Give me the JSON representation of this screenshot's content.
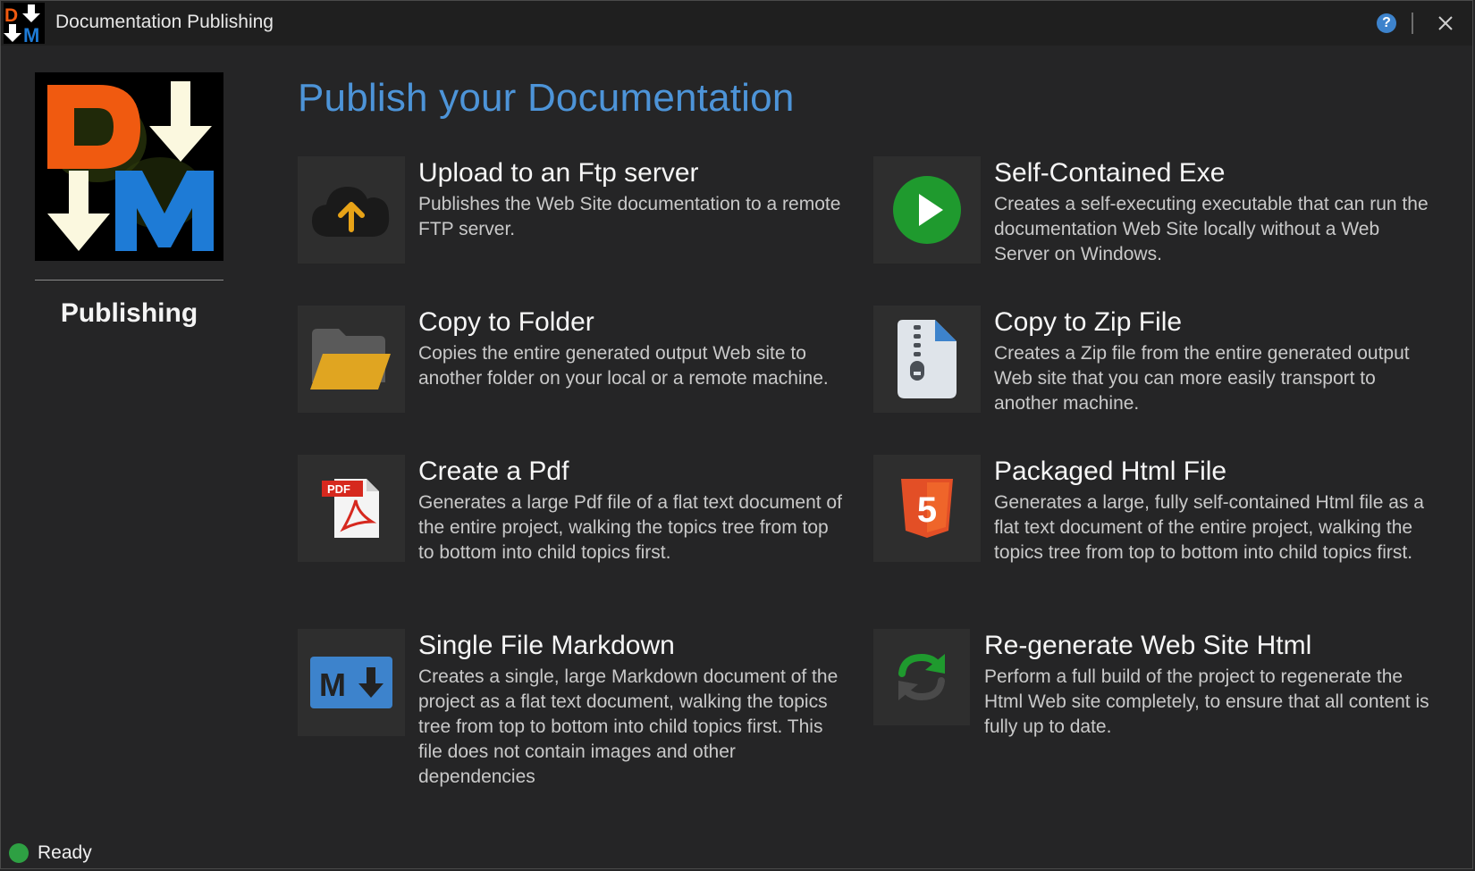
{
  "window": {
    "title": "Documentation Publishing"
  },
  "titlebar": {
    "help_icon": "question-circle-icon",
    "close_icon": "close-icon",
    "help_glyph": "?"
  },
  "sidebar": {
    "logo_letters": [
      "D",
      "M"
    ],
    "label": "Publishing"
  },
  "main": {
    "heading": "Publish your Documentation",
    "options": [
      {
        "title": "Upload to an Ftp server",
        "description": "Publishes the Web Site documentation to a remote FTP server.",
        "icon": "cloud-upload-icon"
      },
      {
        "title": "Self-Contained Exe",
        "description": "Creates a self-executing executable that can run the documentation Web Site locally without a Web Server on Windows.",
        "icon": "play-icon"
      },
      {
        "title": "Copy to Folder",
        "description": "Copies the entire generated output Web site to another folder on your local or a remote machine.",
        "icon": "folder-icon"
      },
      {
        "title": "Copy to Zip File",
        "description": "Creates a Zip file from the entire generated output Web site that you can more easily transport to another machine.",
        "icon": "zip-file-icon"
      },
      {
        "title": "Create a Pdf",
        "description": "Generates a large Pdf file of a flat text document of the entire project, walking the topics tree from top to bottom into child topics first.",
        "icon": "pdf-icon",
        "badge": "PDF"
      },
      {
        "title": "Packaged Html File",
        "description": "Generates a large, fully self-contained Html file as a flat text document of the entire project, walking the topics tree from top to bottom into child topics first.",
        "icon": "html5-icon",
        "badge": "5"
      },
      {
        "title": "Single File Markdown",
        "description": "Creates a single, large Markdown document of the project as a flat text document, walking the topics tree from top to bottom into child topics first. This file does not contain images and other dependencies",
        "icon": "markdown-icon",
        "badge": "M"
      },
      {
        "title": "Re-generate Web Site Html",
        "description": "Perform a full build of the project to regenerate the Html Web site completely, to ensure that all content is fully up to date.",
        "icon": "refresh-icon"
      }
    ]
  },
  "statusbar": {
    "text": "Ready",
    "status_color": "#2ea043"
  },
  "colors": {
    "accent": "#4d94d8",
    "background": "#252526",
    "tile": "#2e2e2e"
  }
}
